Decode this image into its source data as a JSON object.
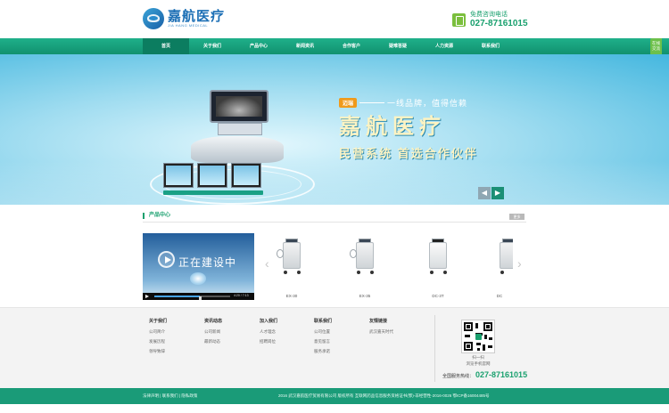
{
  "header": {
    "logo_cn": "嘉航医疗",
    "logo_en": "JIA HANG MEDICAL",
    "hotline_label": "免费咨询电话",
    "hotline_number": "027-87161015"
  },
  "nav": {
    "items": [
      "首页",
      "关于我们",
      "产品中心",
      "新闻资讯",
      "合作客户",
      "疑难答疑",
      "人力资源",
      "联系我们"
    ]
  },
  "side_tab": {
    "label": "在线交流"
  },
  "banner": {
    "badge": "迈瑞",
    "tagline": "一线品牌，值得信赖",
    "title": "嘉航医疗",
    "subtitle": "民营系统 首选合作伙伴"
  },
  "products": {
    "title": "产品中心",
    "more": "更多",
    "video": {
      "overlay_text": "正在建设中",
      "time": "4:20 / 7:13",
      "progress": 0.6
    },
    "items": [
      {
        "caption": "EX-30"
      },
      {
        "caption": "EX-35"
      },
      {
        "caption": "DC-3T"
      },
      {
        "caption": "DC"
      }
    ]
  },
  "footer": {
    "columns": [
      {
        "title": "关于我们",
        "links": [
          "公司简介",
          "发展历程",
          "领导致辞"
        ]
      },
      {
        "title": "资讯动态",
        "links": [
          "公司新闻",
          "最新动态"
        ]
      },
      {
        "title": "加入我们",
        "links": [
          "人才理念",
          "招聘岗位"
        ]
      },
      {
        "title": "联系我们",
        "links": [
          "公司位置",
          "意见留言",
          "服务承诺"
        ]
      },
      {
        "title": "友情链接",
        "links": [
          "武汉嘉天时代"
        ]
      }
    ],
    "qr_caption1": "扫一扫",
    "qr_caption2": "浏览手机官网",
    "hotline_label": "全国服务热线：",
    "hotline_number": "027-87161015"
  },
  "bottom": {
    "links": "法律声明 | 联系我们 | 隐私政策",
    "copyright": "2016 武汉嘉航医疗贸易有限公司 版权所有 互联网药品信息服务资格证书(鄂)-非经营性-2016-0026 鄂ICP备16004485号"
  }
}
